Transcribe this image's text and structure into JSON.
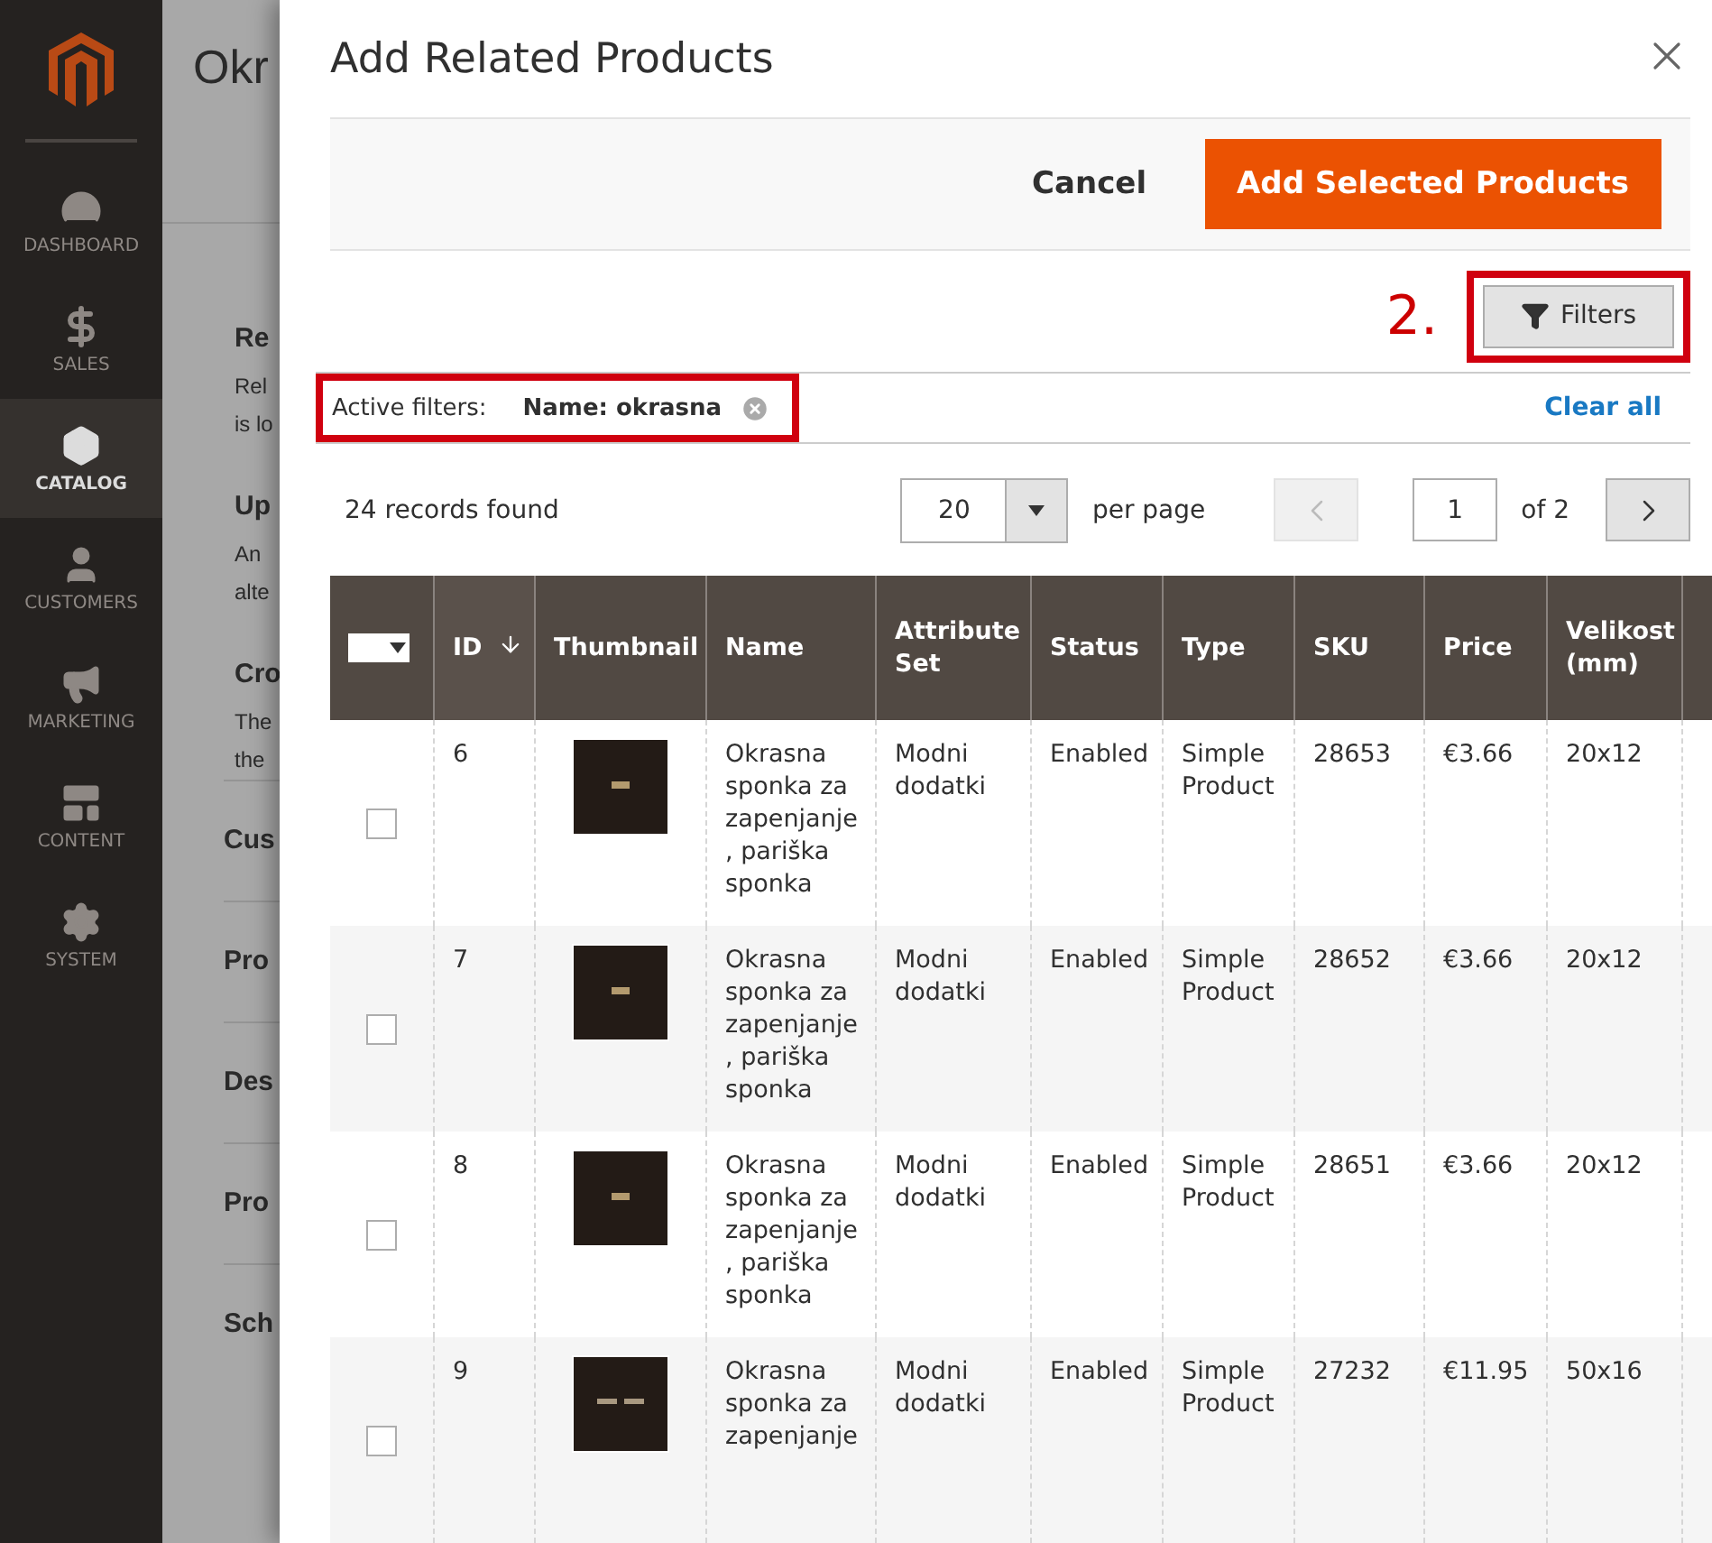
{
  "sidebar": {
    "items": [
      {
        "label": "DASHBOARD",
        "selected": false
      },
      {
        "label": "SALES",
        "selected": false
      },
      {
        "label": "CATALOG",
        "selected": true
      },
      {
        "label": "CUSTOMERS",
        "selected": false
      },
      {
        "label": "MARKETING",
        "selected": false
      },
      {
        "label": "CONTENT",
        "selected": false
      },
      {
        "label": "SYSTEM",
        "selected": false
      }
    ]
  },
  "background_page": {
    "title": "Okr",
    "blocks": [
      {
        "kind": "heading",
        "text": "Re"
      },
      {
        "kind": "body",
        "lines": [
          "Rel",
          "is lo"
        ]
      },
      {
        "kind": "heading",
        "text": "Up"
      },
      {
        "kind": "body",
        "lines": [
          "An",
          "alte"
        ]
      },
      {
        "kind": "heading",
        "text": "Cro"
      },
      {
        "kind": "body",
        "lines": [
          "The",
          "the"
        ]
      },
      {
        "kind": "section",
        "text": "Cus"
      },
      {
        "kind": "section",
        "text": "Pro"
      },
      {
        "kind": "section",
        "text": "Des"
      },
      {
        "kind": "section",
        "text": "Pro"
      },
      {
        "kind": "section",
        "text": "Sch"
      }
    ]
  },
  "modal": {
    "title": "Add Related Products",
    "actions": {
      "cancel": "Cancel",
      "primary": "Add Selected Products"
    },
    "annotation": "2.",
    "filters_button": "Filters",
    "active_filters": {
      "label": "Active filters:",
      "chips": [
        "Name: okrasna"
      ],
      "clear": "Clear all"
    },
    "records": "24 records found",
    "per_page": {
      "value": "20",
      "label": "per page"
    },
    "pager": {
      "page": "1",
      "of": "of 2"
    },
    "table": {
      "columns": [
        {
          "label": "ID",
          "sorted": true
        },
        {
          "label": "Thumbnail",
          "sorted": false
        },
        {
          "label": "Name",
          "sorted": false
        },
        {
          "label": "Attribute Set",
          "sorted": false
        },
        {
          "label": "Status",
          "sorted": false
        },
        {
          "label": "Type",
          "sorted": false
        },
        {
          "label": "SKU",
          "sorted": false
        },
        {
          "label": "Price",
          "sorted": false
        },
        {
          "label": "Velikost (mm)",
          "sorted": false
        }
      ],
      "rows": [
        {
          "checked": false,
          "cells": [
            "6",
            "",
            "Okrasna sponka za zapenjanje , pariška sponka",
            "Modni dodatki",
            "Enabled",
            "Simple Product",
            "28653",
            "€3.66",
            "20x12"
          ]
        },
        {
          "checked": false,
          "cells": [
            "7",
            "",
            "Okrasna sponka za zapenjanje , pariška sponka",
            "Modni dodatki",
            "Enabled",
            "Simple Product",
            "28652",
            "€3.66",
            "20x12"
          ]
        },
        {
          "checked": false,
          "cells": [
            "8",
            "",
            "Okrasna sponka za zapenjanje , pariška sponka",
            "Modni dodatki",
            "Enabled",
            "Simple Product",
            "28651",
            "€3.66",
            "20x12"
          ]
        },
        {
          "checked": false,
          "cells": [
            "9",
            "",
            "Okrasna sponka za zapenjanje",
            "Modni dodatki",
            "Enabled",
            "Simple Product",
            "27232",
            "€11.95",
            "50x16"
          ]
        }
      ]
    }
  }
}
